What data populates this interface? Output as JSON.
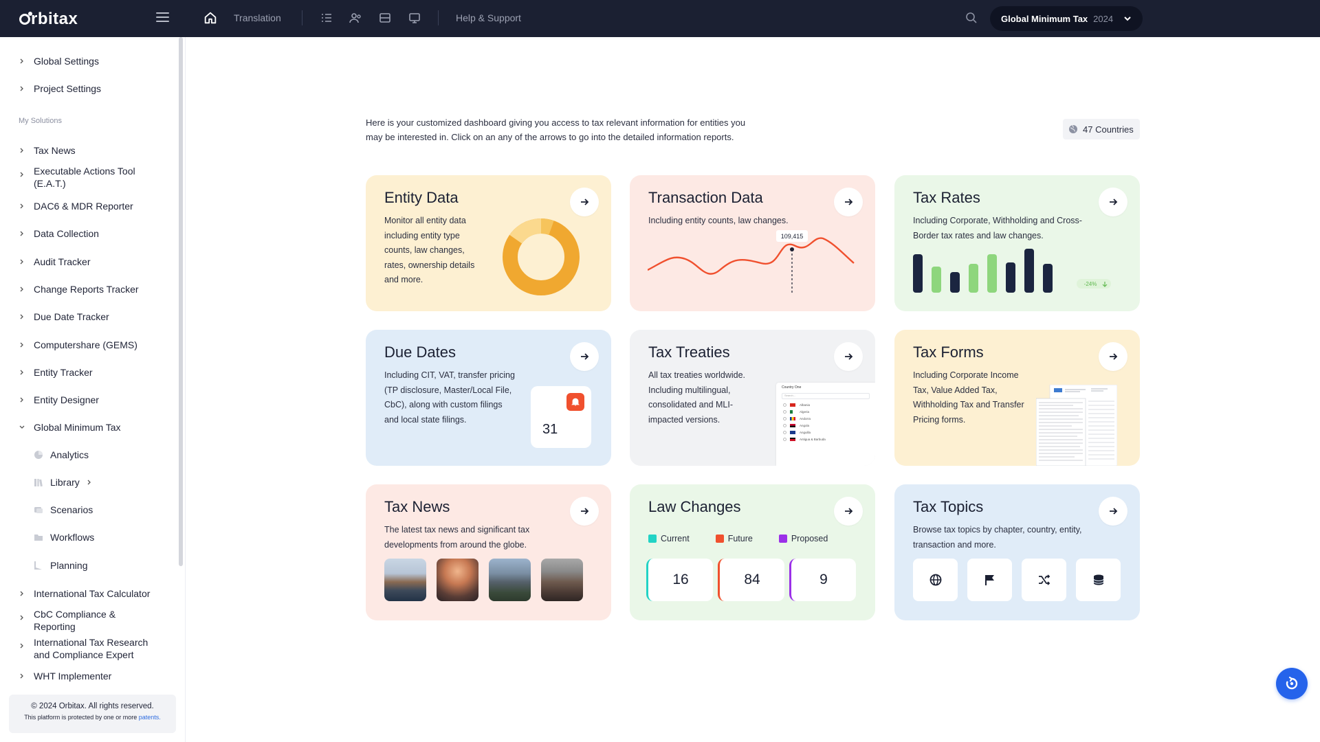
{
  "topbar": {
    "logo": "rbitax",
    "nav": {
      "translation": "Translation",
      "help": "Help & Support"
    },
    "solution": {
      "name": "Global Minimum Tax",
      "year": "2024"
    }
  },
  "sidebar": {
    "top_items": [
      {
        "label": "Global Settings"
      },
      {
        "label": "Project Settings"
      }
    ],
    "section_label": "My Solutions",
    "items": [
      {
        "label": "Tax News"
      },
      {
        "label": "Executable Actions Tool (E.A.T.)"
      },
      {
        "label": "DAC6 & MDR Reporter"
      },
      {
        "label": "Data Collection"
      },
      {
        "label": "Audit Tracker"
      },
      {
        "label": "Change Reports Tracker"
      },
      {
        "label": "Due Date Tracker"
      },
      {
        "label": "Computershare (GEMS)"
      },
      {
        "label": "Entity Tracker"
      },
      {
        "label": "Entity Designer"
      },
      {
        "label": "Global Minimum Tax"
      }
    ],
    "sub_items": [
      {
        "label": "Analytics",
        "icon": "pie-chart-icon"
      },
      {
        "label": "Library",
        "icon": "library-icon"
      },
      {
        "label": "Scenarios",
        "icon": "scenarios-icon"
      },
      {
        "label": "Workflows",
        "icon": "folder-icon"
      },
      {
        "label": "Planning",
        "icon": "planning-icon"
      }
    ],
    "bottom_items": [
      {
        "label": "International Tax Calculator"
      },
      {
        "label": "CbC Compliance & Reporting"
      },
      {
        "label": "International Tax Research and Compliance Expert"
      },
      {
        "label": "WHT Implementer"
      }
    ],
    "footer": {
      "copyright": "© 2024 Orbitax. All rights reserved.",
      "patent_text": "This platform is protected by one or more",
      "patent_link": "patents."
    }
  },
  "main": {
    "intro": "Here is your customized dashboard giving you access to tax relevant information for entities you may be interested in. Click on an any of the arrows to go into the detailed information reports.",
    "countries_badge": "47 Countries",
    "cards": {
      "entity_data": {
        "title": "Entity Data",
        "desc": "Monitor all entity data including entity type counts, law changes, rates, ownership details and more."
      },
      "transaction_data": {
        "title": "Transaction Data",
        "desc": "Including entity counts, law changes.",
        "tooltip_value": "109,415"
      },
      "tax_rates": {
        "title": "Tax Rates",
        "desc": "Including Corporate, Withholding and Cross-Border tax rates and law changes.",
        "badge": "-24%"
      },
      "due_dates": {
        "title": "Due Dates",
        "desc": "Including CIT, VAT, transfer pricing (TP disclosure, Master/Local File, CbC), along with custom filings and local state filings.",
        "calendar_day": "31"
      },
      "tax_treaties": {
        "title": "Tax Treaties",
        "desc": "All tax treaties worldwide. Including multilingual, consolidated and MLI-impacted versions.",
        "preview_header": "Country One",
        "preview_search": "Search...",
        "preview_countries": [
          "Albania",
          "Algeria",
          "Andorra",
          "Angola",
          "Anguilla",
          "Antigua & Barbuda"
        ]
      },
      "tax_forms": {
        "title": "Tax Forms",
        "desc": "Including Corporate Income Tax, Value Added Tax, Withholding Tax and Transfer Pricing forms."
      },
      "tax_news": {
        "title": "Tax News",
        "desc": "The latest tax news and significant tax developments from around the globe."
      },
      "law_changes": {
        "title": "Law Changes",
        "legend": [
          {
            "label": "Current",
            "color": "#22d3c5"
          },
          {
            "label": "Future",
            "color": "#f0502e"
          },
          {
            "label": "Proposed",
            "color": "#9b30e8"
          }
        ],
        "counts": [
          "16",
          "84",
          "9"
        ]
      },
      "tax_topics": {
        "title": "Tax Topics",
        "desc": "Browse tax topics by chapter, country, entity, transaction and more."
      }
    }
  },
  "colors": {
    "topbar": "#1b2032",
    "donut_primary": "#f0a830",
    "donut_light": "#fbd98e",
    "line": "#f0502e",
    "bar_dark": "#1b2540",
    "bar_green": "#8ed67d",
    "fab": "#2563eb"
  }
}
